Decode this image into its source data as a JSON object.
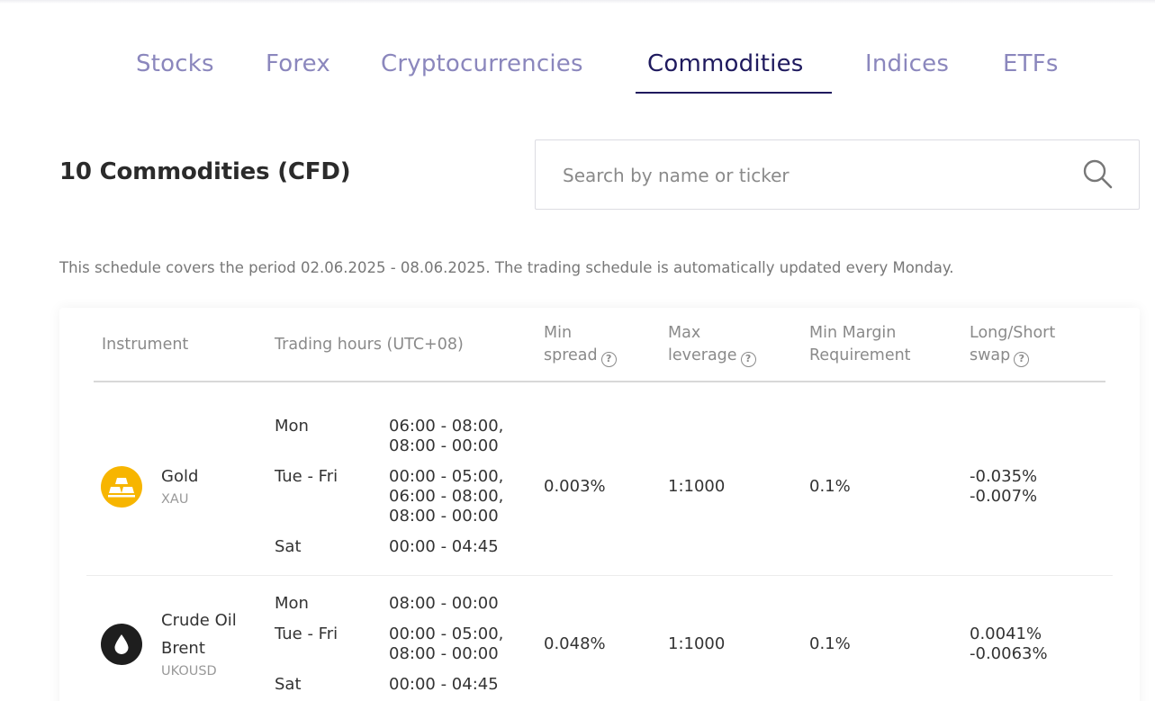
{
  "tabs": [
    {
      "label": "Stocks",
      "active": false
    },
    {
      "label": "Forex",
      "active": false
    },
    {
      "label": "Cryptocurrencies",
      "active": false
    },
    {
      "label": "Commodities",
      "active": true
    },
    {
      "label": "Indices",
      "active": false
    },
    {
      "label": "ETFs",
      "active": false
    }
  ],
  "heading": "10 Commodities (CFD)",
  "search": {
    "placeholder": "Search by name or ticker",
    "value": "",
    "icon": "search-icon"
  },
  "note": "This schedule covers the period 02.06.2025 - 08.06.2025. The trading schedule is automatically updated every Monday.",
  "table": {
    "headers": {
      "instrument": "Instrument",
      "trading_hours": "Trading hours (UTC+08)",
      "min_spread": [
        "Min",
        "spread"
      ],
      "max_leverage": [
        "Max",
        "leverage"
      ],
      "min_margin": [
        "Min Margin",
        "Requirement"
      ],
      "swap": [
        "Long/Short",
        "swap"
      ],
      "help_icon": "?"
    },
    "rows": [
      {
        "name": "Gold",
        "name_lines": [
          "Gold"
        ],
        "ticker": "XAU",
        "icon": "gold-bars-icon",
        "icon_color": "#f7b500",
        "hours": [
          {
            "day": "Mon",
            "times": [
              "06:00 - 08:00,",
              "08:00 - 00:00"
            ]
          },
          {
            "day": "Tue - Fri",
            "times": [
              "00:00 - 05:00,",
              "06:00 - 08:00,",
              "08:00 - 00:00"
            ]
          },
          {
            "day": "Sat",
            "times": [
              "00:00 - 04:45"
            ]
          }
        ],
        "min_spread": "0.003%",
        "max_leverage": "1:1000",
        "min_margin": "0.1%",
        "swap_long": "-0.035%",
        "swap_short": "-0.007%"
      },
      {
        "name": "Crude Oil Brent",
        "name_lines": [
          "Crude Oil",
          "Brent"
        ],
        "ticker": "UKOUSD",
        "icon": "oil-drop-icon",
        "icon_color": "#1e1e1e",
        "hours": [
          {
            "day": "Mon",
            "times": [
              "08:00 - 00:00"
            ]
          },
          {
            "day": "Tue - Fri",
            "times": [
              "00:00 - 05:00,",
              "08:00 - 00:00"
            ]
          },
          {
            "day": "Sat",
            "times": [
              "00:00 - 04:45"
            ]
          }
        ],
        "min_spread": "0.048%",
        "max_leverage": "1:1000",
        "min_margin": "0.1%",
        "swap_long": "0.0041%",
        "swap_short": "-0.0063%"
      }
    ]
  },
  "colors": {
    "tab_inactive": "#8b87bd",
    "tab_active": "#1f1a5e",
    "gold": "#f7b500",
    "oil": "#1e1e1e"
  }
}
